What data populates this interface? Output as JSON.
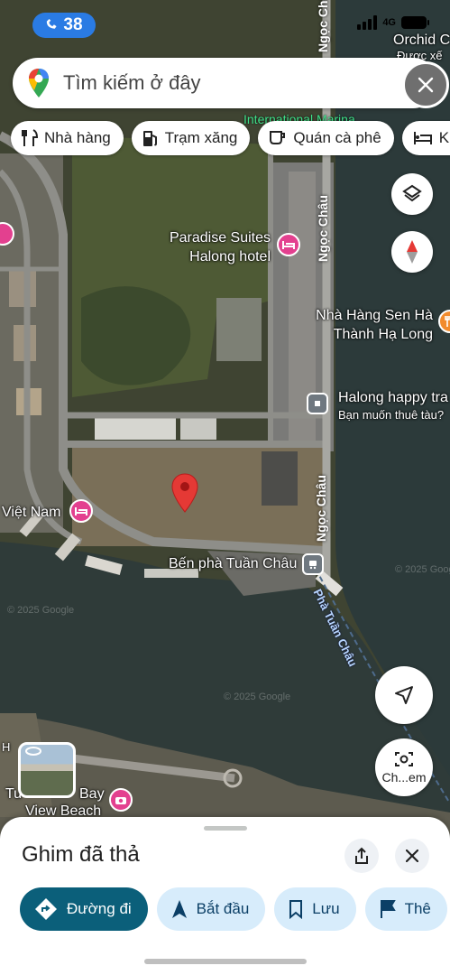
{
  "status_bar": {
    "time": "38",
    "network": "4G"
  },
  "search": {
    "placeholder": "Tìm kiếm ở đây"
  },
  "chips": [
    {
      "label": "Nhà hàng",
      "icon": "restaurant-icon"
    },
    {
      "label": "Trạm xăng",
      "icon": "gas-station-icon"
    },
    {
      "label": "Quán cà phê",
      "icon": "coffee-icon"
    },
    {
      "label": "Kh",
      "icon": "hotel-icon"
    }
  ],
  "map": {
    "labels": {
      "orchid": "Orchid C",
      "orchid_sub": "Được xế",
      "intl_marina": "International Marina",
      "road_ngoc_chau": "Ngọc Châu",
      "paradise_1": "Paradise Suites",
      "paradise_2": "Halong hotel",
      "sen_1": "Nhà Hàng Sen Hà",
      "sen_2": "Thành Hạ Long",
      "happy_1": "Halong happy tra",
      "happy_2": "Bạn muốn thuê tàu?",
      "viet_nam": "Việt Nam",
      "ben_pha": "Bến phà Tuần Châu",
      "pha_tuan_chau": "Phà Tuần Châu",
      "bay_1": "Tu",
      "bay_2": "Bay",
      "bay_3": "View Beach",
      "h_label": "H",
      "watermark": "© 2025 Google"
    }
  },
  "controls": {
    "lens_label": "Ch...em"
  },
  "sheet": {
    "title": "Ghim đã thả",
    "actions": [
      {
        "label": "Đường đi",
        "primary": true
      },
      {
        "label": "Bắt đầu"
      },
      {
        "label": "Lưu"
      },
      {
        "label": "Thê"
      }
    ]
  },
  "colors": {
    "accent": "#0b5f7a",
    "action_bg": "#d7ecfb",
    "pin": "#e53935",
    "poi_pink": "#e3408f"
  }
}
